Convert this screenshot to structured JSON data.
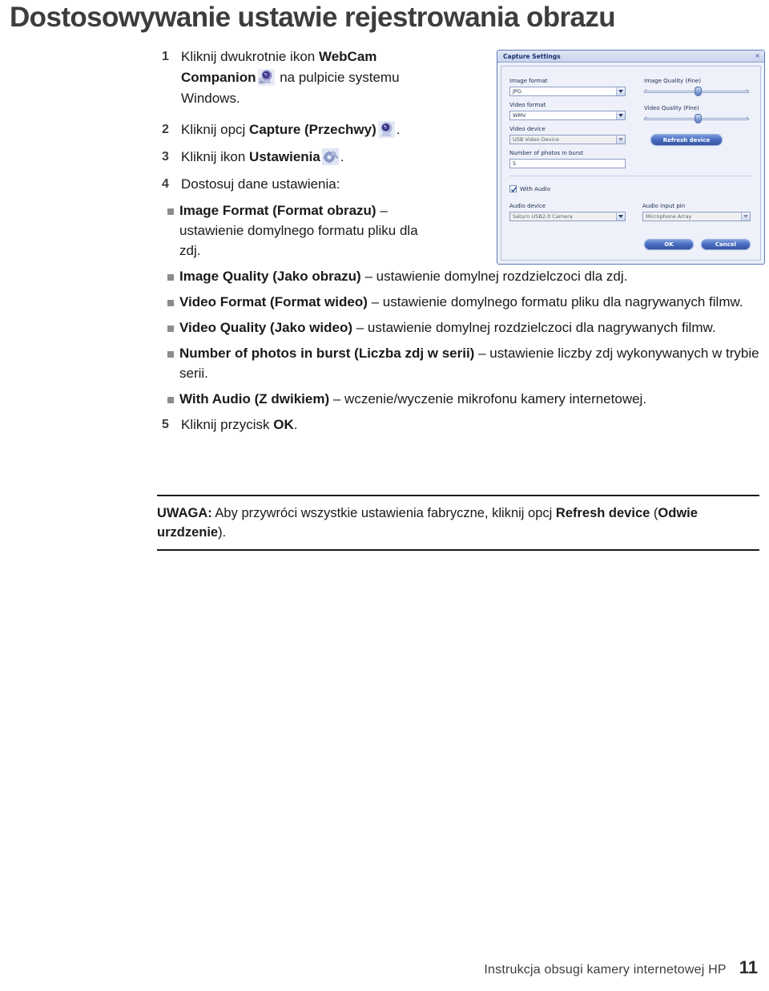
{
  "title": "Dostosowywanie ustawie rejestrowania obrazu",
  "steps": [
    {
      "num": "1",
      "segments": [
        {
          "t": "Kliknij dwukrotnie ikon ",
          "b": false
        },
        {
          "t": "WebCam Companion",
          "b": true
        },
        {
          "t": " ",
          "b": false
        },
        {
          "t": "icon:webcam-companion",
          "b": false
        },
        {
          "t": " na pulpicie systemu Windows.",
          "b": false
        }
      ]
    },
    {
      "num": "2",
      "segments": [
        {
          "t": "Kliknij opcj ",
          "b": false
        },
        {
          "t": "Capture (Przechwy)",
          "b": true
        },
        {
          "t": " ",
          "b": false
        },
        {
          "t": "icon:capture-webcam",
          "b": false
        },
        {
          "t": ".",
          "b": false
        }
      ]
    },
    {
      "num": "3",
      "segments": [
        {
          "t": "Kliknij ikon ",
          "b": false
        },
        {
          "t": "Ustawienia",
          "b": true
        },
        {
          "t": " ",
          "b": false
        },
        {
          "t": "icon:settings-gear",
          "b": false
        },
        {
          "t": ".",
          "b": false
        }
      ]
    },
    {
      "num": "4",
      "segments": [
        {
          "t": "Dostosuj dane ustawienia:",
          "b": false
        }
      ]
    }
  ],
  "bullets": [
    {
      "narrow": true,
      "segments": [
        {
          "t": "Image Format (Format obrazu)",
          "b": true
        },
        {
          "t": " – ustawienie domylnego formatu pliku dla zdj.",
          "b": false
        }
      ]
    },
    {
      "narrow": false,
      "segments": [
        {
          "t": "Image Quality (Jako obrazu)",
          "b": true
        },
        {
          "t": " – ustawienie domylnej rozdzielczoci dla zdj.",
          "b": false
        }
      ]
    },
    {
      "narrow": false,
      "segments": [
        {
          "t": "Video Format (Format wideo)",
          "b": true
        },
        {
          "t": " – ustawienie domylnego formatu pliku dla nagrywanych filmw.",
          "b": false
        }
      ]
    },
    {
      "narrow": false,
      "segments": [
        {
          "t": "Video Quality (Jako wideo)",
          "b": true
        },
        {
          "t": " – ustawienie domylnej rozdzielczoci dla nagrywanych filmw.",
          "b": false
        }
      ]
    },
    {
      "narrow": false,
      "segments": [
        {
          "t": "Number of photos in burst (Liczba zdj w serii)",
          "b": true
        },
        {
          "t": " – ustawienie liczby zdj wykonywanych w trybie serii.",
          "b": false
        }
      ]
    },
    {
      "narrow": false,
      "segments": [
        {
          "t": "With Audio (Z dwikiem)",
          "b": true
        },
        {
          "t": " – wczenie/wyczenie mikrofonu kamery internetowej.",
          "b": false
        }
      ]
    }
  ],
  "step5": {
    "num": "5",
    "segments": [
      {
        "t": "Kliknij przycisk ",
        "b": false
      },
      {
        "t": "OK",
        "b": true
      },
      {
        "t": ".",
        "b": false
      }
    ]
  },
  "note": {
    "segments": [
      {
        "t": "UWAGA:",
        "b": true
      },
      {
        "t": " Aby przywróci wszystkie ustawienia fabryczne, kliknij opcj ",
        "b": false
      },
      {
        "t": "Refresh device",
        "b": true
      },
      {
        "t": " (",
        "b": false
      },
      {
        "t": "Odwie urzdzenie",
        "b": true
      },
      {
        "t": ").",
        "b": false
      }
    ]
  },
  "footer": {
    "text": "Instrukcja obsugi kamery internetowej HP",
    "page": "11"
  },
  "dialog": {
    "title": "Capture Settings",
    "close_label": "×",
    "fields": {
      "image_format_label": "Image format",
      "image_format_value": "JPG",
      "video_format_label": "Video format",
      "video_format_value": "WMV",
      "video_device_label": "Video device",
      "video_device_value": "USB Video Device",
      "burst_label": "Number of photos in burst",
      "burst_value": "5",
      "image_quality_label": "Image Quality  (Fine)",
      "video_quality_label": "Video Quality  (Fine)",
      "refresh_label": "Refresh device",
      "with_audio_label": "With Audio",
      "audio_device_label": "Audio device",
      "audio_device_value": "Saturn USB2.0 Camera",
      "audio_pin_label": "Audio input pin",
      "audio_pin_value": "Microphone Array",
      "ok_label": "OK",
      "cancel_label": "Cancel"
    },
    "slider_values": {
      "image_quality_pct": 52,
      "video_quality_pct": 52
    },
    "colors": {
      "titlebar": "#c9d4ee",
      "body": "#eef1fa",
      "border": "#5d77b5",
      "button": "#4a6fc4",
      "title_text": "#17306e"
    }
  }
}
